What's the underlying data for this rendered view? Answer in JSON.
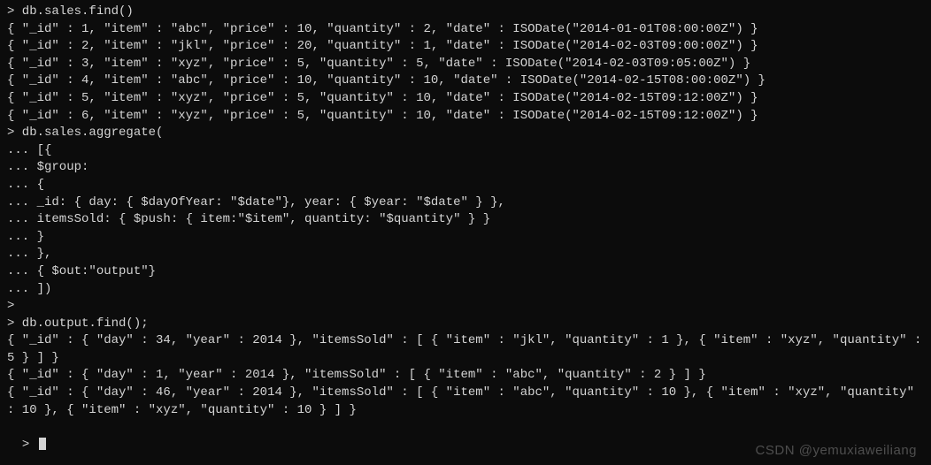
{
  "terminal": {
    "lines": [
      "> db.sales.find()",
      "{ \"_id\" : 1, \"item\" : \"abc\", \"price\" : 10, \"quantity\" : 2, \"date\" : ISODate(\"2014-01-01T08:00:00Z\") }",
      "{ \"_id\" : 2, \"item\" : \"jkl\", \"price\" : 20, \"quantity\" : 1, \"date\" : ISODate(\"2014-02-03T09:00:00Z\") }",
      "{ \"_id\" : 3, \"item\" : \"xyz\", \"price\" : 5, \"quantity\" : 5, \"date\" : ISODate(\"2014-02-03T09:05:00Z\") }",
      "{ \"_id\" : 4, \"item\" : \"abc\", \"price\" : 10, \"quantity\" : 10, \"date\" : ISODate(\"2014-02-15T08:00:00Z\") }",
      "{ \"_id\" : 5, \"item\" : \"xyz\", \"price\" : 5, \"quantity\" : 10, \"date\" : ISODate(\"2014-02-15T09:12:00Z\") }",
      "{ \"_id\" : 6, \"item\" : \"xyz\", \"price\" : 5, \"quantity\" : 10, \"date\" : ISODate(\"2014-02-15T09:12:00Z\") }",
      "> db.sales.aggregate(",
      "... [{",
      "... $group:",
      "... {",
      "... _id: { day: { $dayOfYear: \"$date\"}, year: { $year: \"$date\" } },",
      "... itemsSold: { $push: { item:\"$item\", quantity: \"$quantity\" } }",
      "... }",
      "... },",
      "... { $out:\"output\"}",
      "... ])",
      ">",
      "> db.output.find();",
      "{ \"_id\" : { \"day\" : 34, \"year\" : 2014 }, \"itemsSold\" : [ { \"item\" : \"jkl\", \"quantity\" : 1 }, { \"item\" : \"xyz\", \"quantity\" : 5 } ] }",
      "{ \"_id\" : { \"day\" : 1, \"year\" : 2014 }, \"itemsSold\" : [ { \"item\" : \"abc\", \"quantity\" : 2 } ] }",
      "{ \"_id\" : { \"day\" : 46, \"year\" : 2014 }, \"itemsSold\" : [ { \"item\" : \"abc\", \"quantity\" : 10 }, { \"item\" : \"xyz\", \"quantity\" : 10 }, { \"item\" : \"xyz\", \"quantity\" : 10 } ] }"
    ],
    "final_prompt": "> "
  },
  "watermark": "CSDN @yemuxiaweiliang"
}
